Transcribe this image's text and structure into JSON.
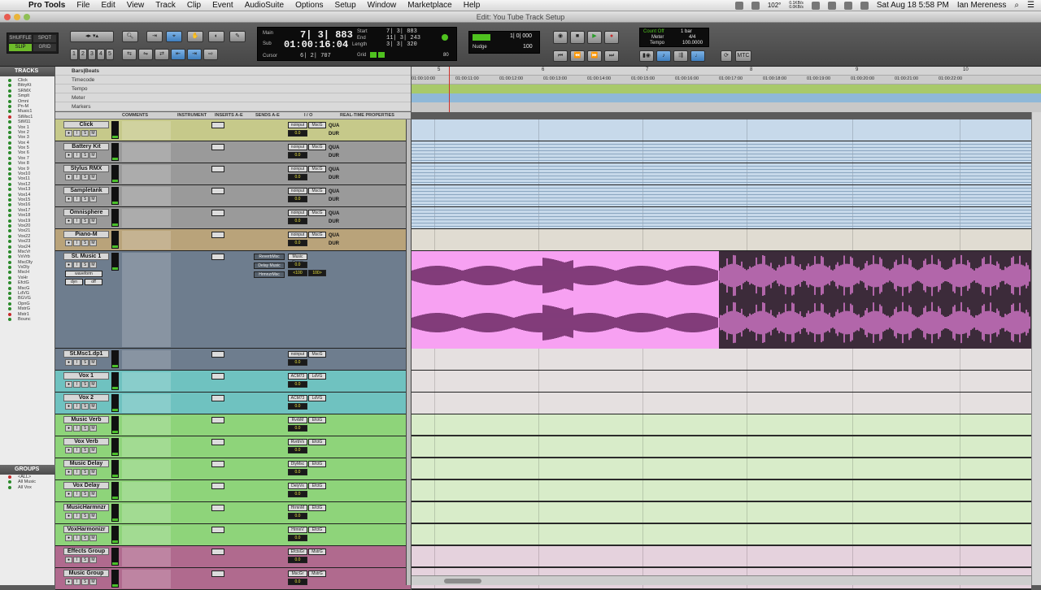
{
  "menubar": {
    "items": [
      "Pro Tools",
      "File",
      "Edit",
      "View",
      "Track",
      "Clip",
      "Event",
      "AudioSuite",
      "Options",
      "Setup",
      "Window",
      "Marketplace",
      "Help"
    ],
    "battery": "102°",
    "clock": "Sat Aug 18  5:58 PM",
    "user": "Ian Mereness",
    "net_down": "0.1KB/s",
    "net_up": "0.0KB/s"
  },
  "window": {
    "title": "Edit: You Tube Track Setup"
  },
  "toolbar": {
    "modes": [
      "SHUFFLE",
      "SPOT",
      "SLIP",
      "GRID"
    ],
    "active_mode": "SLIP",
    "zoom_presets": [
      "1",
      "2",
      "3",
      "4",
      "5"
    ],
    "counter": {
      "main_label": "Main",
      "sub_label": "Sub",
      "main": "7| 3| 883",
      "sub": "01:00:16:04",
      "start_label": "Start",
      "end_label": "End",
      "length_label": "Length",
      "start": "7| 3| 883",
      "end": "11| 3| 243",
      "length": "3| 3| 320",
      "cursor_label": "Cursor",
      "cursor": "6| 2| 707",
      "grid_value": "1| 0| 000",
      "nudge_label": "Nudge",
      "nudge_value": "1| 0| 000",
      "tempo_value": "100",
      "meter_value": "4/4",
      "count_off": "Count Off",
      "meter_label": "Meter",
      "tempo_label": "Tempo",
      "bars": "1 bar",
      "tempo_precise": "100.0000",
      "minus_value": "80",
      "grid_label": "Grid"
    },
    "mtc_label": "MTC"
  },
  "left_panel": {
    "tracks_header": "TRACKS",
    "groups_header": "GROUPS",
    "tracks": [
      "Click",
      "BttryKt",
      "SRMX",
      "Smplt",
      "Omni",
      "Pn-M",
      "Music1",
      "StMsc1",
      "StM11",
      "Vox 1",
      "Vox 2",
      "Vox 3",
      "Vox 4",
      "Vox 5",
      "Vox 6",
      "Vox 7",
      "Vox 8",
      "Vox 9",
      "Vox10",
      "Vox11",
      "Vox12",
      "Vox13",
      "Vox14",
      "Vox15",
      "Vox16",
      "Vox17",
      "Vox18",
      "Vox19",
      "Vox20",
      "Vox21",
      "Vox22",
      "Vox23",
      "Vox24",
      "MscVr",
      "VxVrb",
      "MscDly",
      "VxDly",
      "MscH",
      "VxHr",
      "EfctG",
      "MscG",
      "LdVG",
      "BGVG",
      "OpnG",
      "MstrG",
      "Mstr1",
      "Bounc"
    ],
    "groups": [
      "<ALL>",
      "All Music",
      "All Vox"
    ]
  },
  "columns": {
    "comments": "COMMENTS",
    "instrument": "INSTRUMENT",
    "inserts": "INSERTS A-E",
    "sends": "SENDS A-E",
    "io": "I / O",
    "rtp": "REAL-TIME PROPERTIES"
  },
  "rulers": {
    "bars_beats": "Bars|Beats",
    "timecode": "Timecode",
    "tempo": "Tempo",
    "meter": "Meter",
    "markers": "Markers",
    "timecodes": [
      "01:00:10:00",
      "01:00:11:00",
      "01:00:12:00",
      "01:00:13:00",
      "01:00:14:00",
      "01:00:15:00",
      "01:00:16:00",
      "01:00:17:00",
      "01:00:18:00",
      "01:00:19:00",
      "01:00:20:00",
      "01:00:21:00",
      "01:00:22:00"
    ],
    "bars": [
      "5",
      "6",
      "7",
      "8",
      "9",
      "10"
    ]
  },
  "tracks": [
    {
      "name": "Click",
      "color": "#c6c98a",
      "lane": "#c7d9ea",
      "io_in": "noinput",
      "io_out": "MscG",
      "vol": "0.0",
      "rtp": "QUA DUR"
    },
    {
      "name": "Battery Kit",
      "color": "#9a9a9a",
      "lane": "#c7d9ea",
      "io_in": "noinput",
      "io_out": "MscG",
      "vol": "0.0",
      "rtp": "QUA DUR"
    },
    {
      "name": "Stylus RMX",
      "color": "#9a9a9a",
      "lane": "#c7d9ea",
      "io_in": "noinput",
      "io_out": "MscG",
      "vol": "0.0",
      "rtp": "QUA DUR"
    },
    {
      "name": "Sampletank",
      "color": "#9a9a9a",
      "lane": "#c7d9ea",
      "io_in": "noinput",
      "io_out": "MscG",
      "vol": "0.0",
      "rtp": "QUA DUR"
    },
    {
      "name": "Omnisphere",
      "color": "#9a9a9a",
      "lane": "#c7d9ea",
      "io_in": "noinput",
      "io_out": "MscG",
      "vol": "0.0",
      "rtp": "QUA DUR"
    },
    {
      "name": "Piano-M",
      "color": "#b9a37a",
      "lane": "#e0dcd2",
      "io_in": "noinput",
      "io_out": "MscG",
      "vol": "0.0",
      "rtp": "QUA DUR"
    },
    {
      "name": "St. Music 1",
      "color": "#6e7d8e",
      "lane": "#f7a1f2",
      "io_in": "Music Group",
      "io_out": "",
      "vol": "0.0",
      "pan_l": "<100",
      "pan_r": "100>",
      "sends": [
        "ReverbMsc",
        "Delay Music",
        "HrmnzrMsc"
      ],
      "view": "waveform",
      "dyn": "dyn",
      "off": "off"
    },
    {
      "name": "St.Msc1.dp1",
      "color": "#6e7d8e",
      "lane": "#e5e0e0",
      "io_in": "noinput",
      "io_out": "MscG",
      "vol": "0.0"
    },
    {
      "name": "Vox 1",
      "color": "#6fc2c0",
      "lane": "#e5e0e0",
      "io_in": "ACM73",
      "io_out": "LdVG",
      "vol": "0.0"
    },
    {
      "name": "Vox 2",
      "color": "#6fc2c0",
      "lane": "#e5e0e0",
      "io_in": "ACM73",
      "io_out": "LdVG",
      "vol": "0.0"
    },
    {
      "name": "Music Verb",
      "color": "#8ed47a",
      "lane": "#d8ecc9",
      "io_in": "RvrbM",
      "io_out": "EfctG",
      "vol": "0.0"
    },
    {
      "name": "Vox Verb",
      "color": "#8ed47a",
      "lane": "#d8ecc9",
      "io_in": "RvrbVx",
      "io_out": "EfctG",
      "vol": "0.0"
    },
    {
      "name": "Music Delay",
      "color": "#8ed47a",
      "lane": "#d8ecc9",
      "io_in": "DlyMsc",
      "io_out": "EfctG",
      "vol": "0.0"
    },
    {
      "name": "Vox Delay",
      "color": "#8ed47a",
      "lane": "#d8ecc9",
      "io_in": "DelyVx",
      "io_out": "EfctG",
      "vol": "0.0"
    },
    {
      "name": "MusicHarmnzr",
      "color": "#8ed47a",
      "lane": "#d8ecc9",
      "io_in": "HrmnM",
      "io_out": "EfctG",
      "vol": "0.0"
    },
    {
      "name": "VoxHarmonizr",
      "color": "#8ed47a",
      "lane": "#d8ecc9",
      "io_in": "HrmnV",
      "io_out": "EfctG",
      "vol": "0.0"
    },
    {
      "name": "Effects Group",
      "color": "#b06a8e",
      "lane": "#e5d2dd",
      "io_in": "EfctsGr",
      "io_out": "MstrG",
      "vol": "0.0"
    },
    {
      "name": "Music Group",
      "color": "#b06a8e",
      "lane": "#e5d2dd",
      "io_in": "MscGr",
      "io_out": "MstrG",
      "vol": "0.0"
    }
  ],
  "colors": {
    "instrument_lane": "#c7d9ea",
    "music_region": "#f7a1f2",
    "music_region_sel": "#3c2b3a",
    "waveform_dark": "#5a1b52",
    "waveform_light": "#d97bd0"
  }
}
